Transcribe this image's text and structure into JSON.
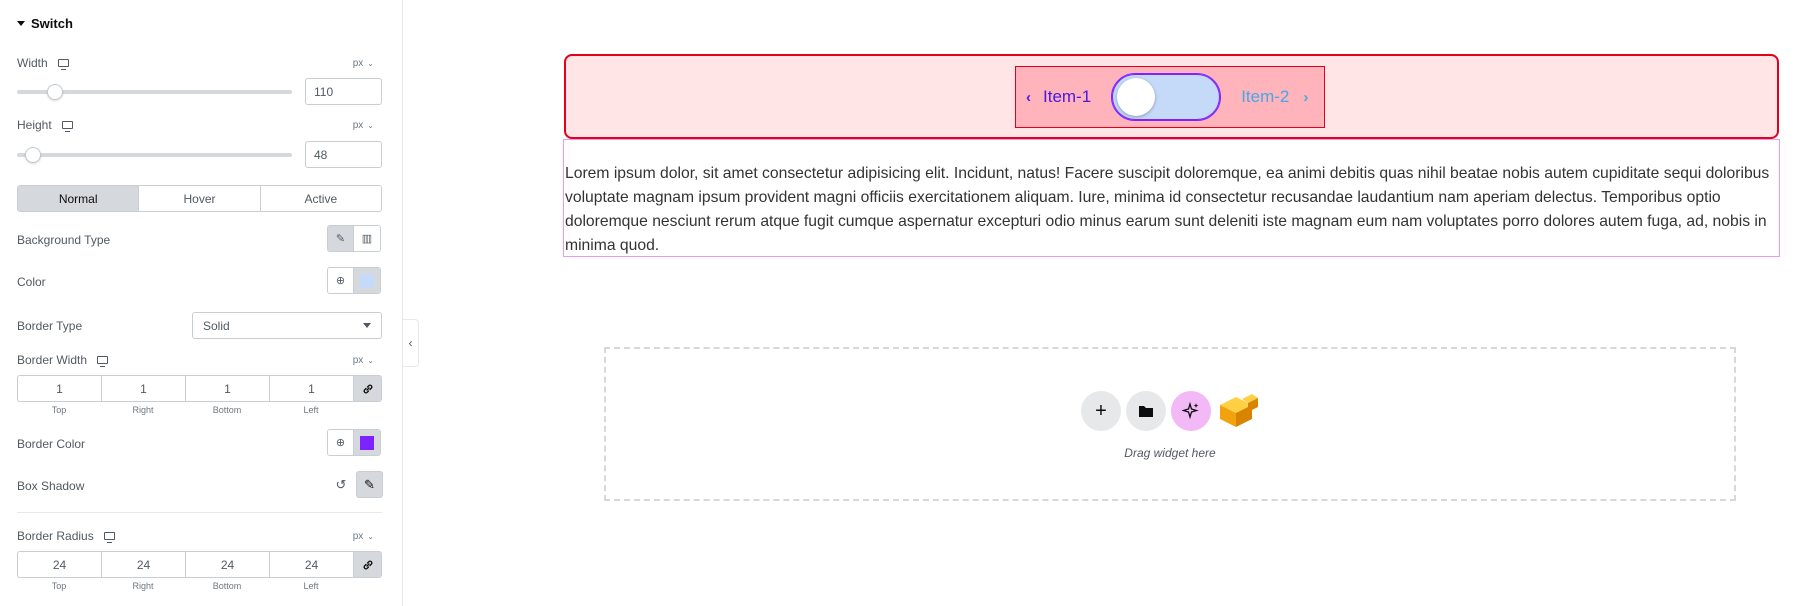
{
  "panel": {
    "section_title": "Switch",
    "width": {
      "label": "Width",
      "unit": "px",
      "value": "110",
      "slider_fraction": 0.12
    },
    "height": {
      "label": "Height",
      "unit": "px",
      "value": "48",
      "slider_fraction": 0.05
    },
    "state_tabs": [
      {
        "label": "Normal",
        "active": true
      },
      {
        "label": "Hover",
        "active": false
      },
      {
        "label": "Active",
        "active": false
      }
    ],
    "background_type_label": "Background Type",
    "color_label": "Color",
    "color_swatch": "#c5d9f8",
    "border_type_label": "Border Type",
    "border_type_value": "Solid",
    "border_width": {
      "label": "Border Width",
      "unit": "px",
      "values": [
        "1",
        "1",
        "1",
        "1"
      ],
      "sides": [
        "Top",
        "Right",
        "Bottom",
        "Left"
      ]
    },
    "border_color_label": "Border Color",
    "border_color_swatch": "#7c23ff",
    "box_shadow_label": "Box Shadow",
    "border_radius": {
      "label": "Border Radius",
      "unit": "px",
      "values": [
        "24",
        "24",
        "24",
        "24"
      ],
      "sides": [
        "Top",
        "Right",
        "Bottom",
        "Left"
      ]
    }
  },
  "canvas": {
    "switch": {
      "item1": "Item-1",
      "item2": "Item-2"
    },
    "paragraph": "Lorem ipsum dolor, sit amet consectetur adipisicing elit. Incidunt, natus! Facere suscipit doloremque, ea animi debitis quas nihil beatae nobis autem cupiditate sequi doloribus voluptate magnam ipsum provident magni officiis exercitationem aliquam. Iure, minima id consectetur recusandae laudantium nam aperiam delectus. Temporibus optio doloremque nesciunt rerum atque fugit cumque aspernatur excepturi odio minus earum sunt deleniti iste magnam eum nam voluptates porro dolores autem fuga, ad, nobis in minima quod.",
    "drop_zone_text": "Drag widget here"
  }
}
